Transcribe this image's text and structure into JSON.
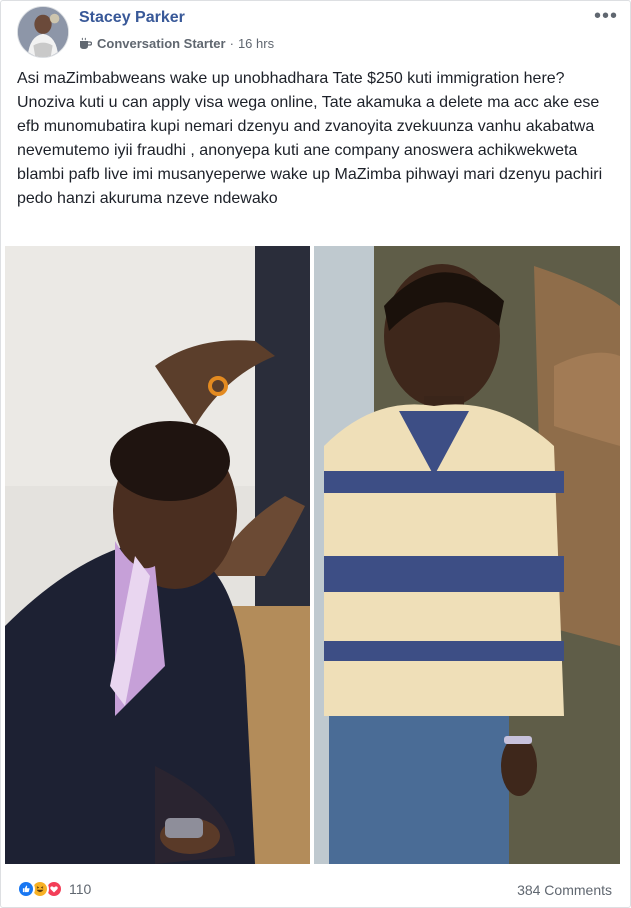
{
  "post": {
    "author": "Stacey Parker",
    "badge": {
      "icon": "coffee-cup-icon",
      "label": "Conversation Starter"
    },
    "separator": "·",
    "timestamp": "16 hrs",
    "more_icon": "more-options-icon",
    "text": "Asi maZimbabweans wake up unobhadhara Tate $250 kuti immigration here? Unoziva kuti u can apply visa wega online, Tate akamuka a delete ma acc ake ese efb munomubatira kupi nemari dzenyu and zvanoyita zvekuunza vanhu akabatwa nevemutemo iyii fraudhi , anonyepa kuti ane company anoswera achikwekweta blambi pafb live imi musanyeperwe wake up MaZimba pihwayi mari dzenyu pachiri pedo hanzi akuruma nzeve ndewako",
    "photos": [
      {
        "icon": "photo-man-suit"
      },
      {
        "icon": "photo-man-striped-shirt"
      }
    ],
    "reactions": {
      "types": [
        "like",
        "haha",
        "love"
      ],
      "count": "110"
    },
    "comments_label": "384 Comments"
  },
  "colors": {
    "author_link": "#385898",
    "meta_text": "#606770",
    "like_blue": "#1877f2",
    "haha_yellow": "#f7b125",
    "love_red": "#f33e58"
  }
}
